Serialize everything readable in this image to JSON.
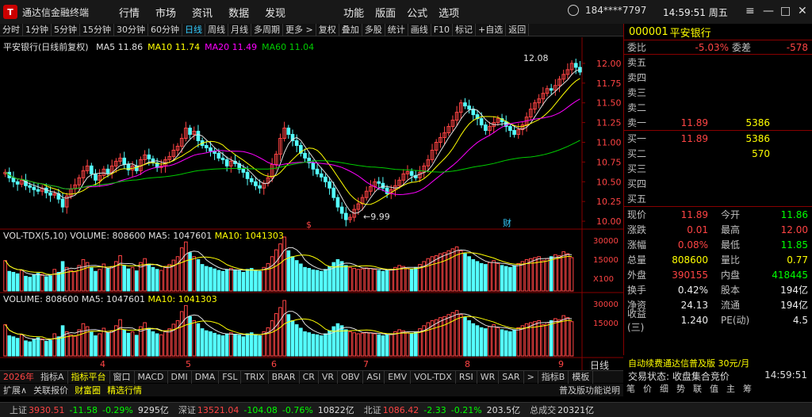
{
  "app": {
    "name": "通达信金融终端",
    "logo": "T"
  },
  "menu_left": [
    "行情",
    "市场",
    "资讯",
    "数据",
    "发现"
  ],
  "menu_right": [
    "功能",
    "版面",
    "公式",
    "选项"
  ],
  "user": "184****7797",
  "clock": "14:59:51 周五",
  "toolbar": [
    "分时",
    "1分钟",
    "5分钟",
    "15分钟",
    "30分钟",
    "60分钟",
    "日线",
    "周线",
    "月线",
    "多周期",
    "更多 >",
    "复权",
    "叠加",
    "多股",
    "统计",
    "画线",
    "F10",
    "标记",
    "+自选",
    "返回"
  ],
  "toolbar_active": "日线",
  "chart_data": {
    "type": "candlestick",
    "title": "平安银行(日线前复权)",
    "ma": [
      {
        "name": "MA5",
        "value": "11.86",
        "color": "#e0e0e0"
      },
      {
        "name": "MA10",
        "value": "11.74",
        "color": "#ffff00"
      },
      {
        "name": "MA20",
        "value": "11.49",
        "color": "#ff00ff"
      },
      {
        "name": "MA60",
        "value": "11.04",
        "color": "#00cc00"
      }
    ],
    "price_ticks": [
      "12.00",
      "11.75",
      "11.50",
      "11.25",
      "11.00",
      "10.75",
      "10.50",
      "10.25",
      "10.00"
    ],
    "ylim": [
      9.92,
      12.13
    ],
    "high_label": "12.08",
    "low_label": "9.99",
    "month_labels": [
      "2026年",
      "4",
      "5",
      "6",
      "7",
      "8",
      "9"
    ],
    "marks": [
      "$",
      "财"
    ],
    "vol_legend": {
      "name": "VOL-TDX(5,10)",
      "volume": "808600",
      "ma5": "1047601",
      "ma10": "1041303"
    },
    "vol_ticks": [
      "30000",
      "15000",
      "X100"
    ],
    "vol2_legend": {
      "name": "VOLUME: 808600",
      "ma5": "MA5: 1047601",
      "ma10": "MA10: 1041303"
    },
    "vol2_ticks": [
      "30000",
      "15000"
    ],
    "closes": [
      10.62,
      10.55,
      10.5,
      10.47,
      10.52,
      10.45,
      10.43,
      10.4,
      10.38,
      10.42,
      10.36,
      10.33,
      10.35,
      10.28,
      10.18,
      10.32,
      10.41,
      10.46,
      10.55,
      10.64,
      10.7,
      10.6,
      10.52,
      10.58,
      10.66,
      10.61,
      10.7,
      10.76,
      10.8,
      10.72,
      10.65,
      10.7,
      10.64,
      10.78,
      10.84,
      10.79,
      10.74,
      10.68,
      10.7,
      10.78,
      10.82,
      10.9,
      10.95,
      11.05,
      11.18,
      11.1,
      11.14,
      11.02,
      10.96,
      10.93,
      10.89,
      10.86,
      10.8,
      10.78,
      10.7,
      10.76,
      10.73,
      10.66,
      10.62,
      10.54,
      10.5,
      10.45,
      10.42,
      10.48,
      10.55,
      10.72,
      10.85,
      11.05,
      11.18,
      11.1,
      11.02,
      10.96,
      10.86,
      10.8,
      10.74,
      10.66,
      10.6,
      10.56,
      10.5,
      10.42,
      10.3,
      10.18,
      10.1,
      10.02,
      10.05,
      10.15,
      10.22,
      10.3,
      10.38,
      10.44,
      10.5,
      10.48,
      10.42,
      10.35,
      10.4,
      10.45,
      10.52,
      10.6,
      10.63,
      10.58,
      10.55,
      10.62,
      10.7,
      10.78,
      10.9,
      11.0,
      11.06,
      11.12,
      11.2,
      11.28,
      11.38,
      11.5,
      11.46,
      11.42,
      11.35,
      11.3,
      11.22,
      11.15,
      11.2,
      11.25,
      11.3,
      11.26,
      11.2,
      11.15,
      11.1,
      11.16,
      11.22,
      11.32,
      11.42,
      11.5,
      11.55,
      11.62,
      11.68,
      11.66,
      11.72,
      11.8,
      11.86,
      11.92,
      12.0,
      11.95,
      11.89
    ],
    "vols": [
      62,
      40,
      38,
      35,
      42,
      30,
      28,
      33,
      36,
      34,
      29,
      31,
      44,
      38,
      60,
      48,
      42,
      39,
      52,
      64,
      58,
      47,
      40,
      44,
      55,
      46,
      50,
      60,
      72,
      52,
      45,
      48,
      41,
      58,
      66,
      55,
      48,
      44,
      42,
      50,
      54,
      63,
      70,
      88,
      100,
      78,
      70,
      64,
      54,
      50,
      48,
      45,
      42,
      40,
      44,
      46,
      43,
      41,
      38,
      44,
      46,
      42,
      40,
      48,
      56,
      70,
      84,
      96,
      110,
      82,
      70,
      62,
      55,
      48,
      46,
      43,
      42,
      40,
      44,
      50,
      58,
      64,
      60,
      52,
      48,
      46,
      44,
      45,
      47,
      46,
      44,
      42,
      40,
      42,
      44,
      48,
      52,
      50,
      46,
      44,
      48,
      54,
      60,
      66,
      70,
      72,
      76,
      78,
      82,
      86,
      90,
      82,
      76,
      70,
      64,
      60,
      56,
      54,
      58,
      62,
      56,
      52,
      50,
      48,
      52,
      56,
      60,
      64,
      66,
      68,
      70,
      62,
      66,
      70,
      74,
      72,
      80,
      76,
      68
    ]
  },
  "stock": {
    "code": "000001",
    "name": "平安银行"
  },
  "order_book": {
    "weibi": {
      "label": "委比",
      "value": "-5.03%",
      "label2": "委差",
      "value2": "-578"
    },
    "sells": [
      {
        "label": "卖五",
        "price": "",
        "vol": ""
      },
      {
        "label": "卖四",
        "price": "",
        "vol": ""
      },
      {
        "label": "卖三",
        "price": "",
        "vol": ""
      },
      {
        "label": "卖二",
        "price": "",
        "vol": ""
      },
      {
        "label": "卖一",
        "price": "11.89",
        "vol": "5386"
      }
    ],
    "buys": [
      {
        "label": "买一",
        "price": "11.89",
        "vol": "5386"
      },
      {
        "label": "买二",
        "price": "",
        "vol": "570"
      },
      {
        "label": "买三",
        "price": "",
        "vol": ""
      },
      {
        "label": "买四",
        "price": "",
        "vol": ""
      },
      {
        "label": "买五",
        "price": "",
        "vol": ""
      }
    ]
  },
  "quote": [
    {
      "k": "现价",
      "v": "11.89",
      "vc": "red",
      "k2": "今开",
      "v2": "11.86",
      "v2c": "green"
    },
    {
      "k": "涨跌",
      "v": "0.01",
      "vc": "red",
      "k2": "最高",
      "v2": "12.00",
      "v2c": "red"
    },
    {
      "k": "涨幅",
      "v": "0.08%",
      "vc": "red",
      "k2": "最低",
      "v2": "11.85",
      "v2c": "green"
    },
    {
      "k": "总量",
      "v": "808600",
      "vc": "yellow",
      "k2": "量比",
      "v2": "0.77",
      "v2c": "yellow"
    },
    {
      "k": "外盘",
      "v": "390155",
      "vc": "red",
      "k2": "内盘",
      "v2": "418445",
      "v2c": "green"
    },
    {
      "k": "换手",
      "v": "0.42%",
      "vc": "white",
      "k2": "股本",
      "v2": "194亿",
      "v2c": "white"
    },
    {
      "k": "净资",
      "v": "24.13",
      "vc": "white",
      "k2": "流通",
      "v2": "194亿",
      "v2c": "white"
    },
    {
      "k": "收益(三)",
      "v": "1.240",
      "vc": "white",
      "k2": "PE(动)",
      "v2": "4.5",
      "v2c": "white"
    }
  ],
  "promo": "自动续费通达信普及版 30元/月",
  "trade_status": {
    "label": "交易状态: 收盘集合竞价",
    "time": "14:59:51"
  },
  "rtools": [
    "笔",
    "价",
    "细",
    "势",
    "联",
    "值",
    "主",
    "筹"
  ],
  "tabs": [
    "指标A",
    "指标平台",
    "窗口",
    "MACD",
    "DMI",
    "DMA",
    "FSL",
    "TRIX",
    "BRAR",
    "CR",
    "VR",
    "OBV",
    "ASI",
    "EMV",
    "VOL-TDX",
    "RSI",
    "WR",
    "SAR",
    ">",
    "指标B",
    "模板"
  ],
  "tabs_active": "指标平台",
  "subtabs": [
    "扩展∧",
    "关联报价",
    "财富圈",
    "精选行情"
  ],
  "subtabs_right": "普及版功能说明",
  "right_side_label": "日线",
  "status": [
    {
      "k": "上证",
      "v": "3930.51",
      "c": "#f44"
    },
    {
      "k": "",
      "v": "-11.58",
      "c": "#0f0"
    },
    {
      "k": "",
      "v": "-0.29%",
      "c": "#0f0"
    },
    {
      "k": "",
      "v": "9295亿",
      "c": "#ddd"
    },
    {
      "k": "深证",
      "v": "13521.04",
      "c": "#f44"
    },
    {
      "k": "",
      "v": "-104.08",
      "c": "#0f0"
    },
    {
      "k": "",
      "v": "-0.76%",
      "c": "#0f0"
    },
    {
      "k": "",
      "v": "10822亿",
      "c": "#ddd"
    },
    {
      "k": "北证",
      "v": "1086.42",
      "c": "#f44"
    },
    {
      "k": "",
      "v": "-2.33",
      "c": "#0f0"
    },
    {
      "k": "",
      "v": "-0.21%",
      "c": "#0f0"
    },
    {
      "k": "",
      "v": "203.5亿",
      "c": "#ddd"
    },
    {
      "k": "总成交",
      "v": "20321亿",
      "c": "#ddd"
    }
  ]
}
